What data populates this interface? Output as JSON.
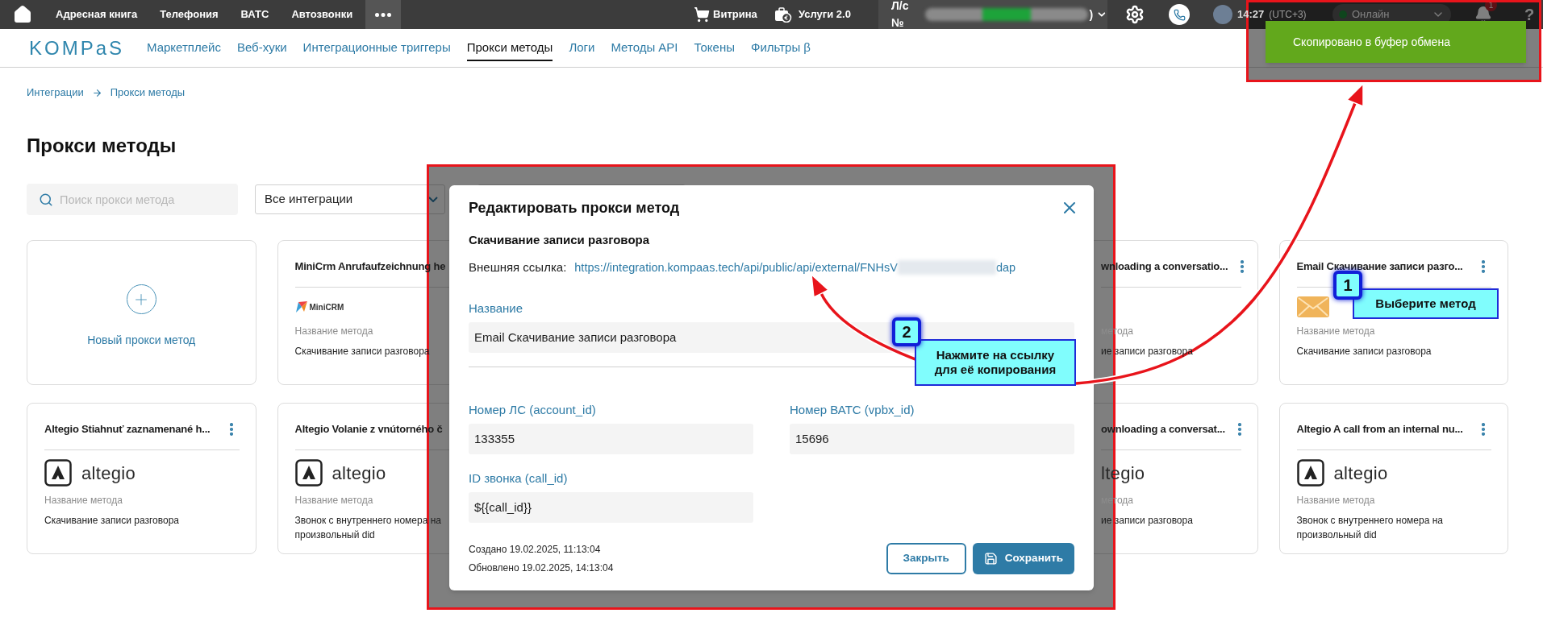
{
  "top_bar": {
    "nav_items": [
      {
        "label": "Адресная книга"
      },
      {
        "label": "Телефония"
      },
      {
        "label": "ВАТС"
      },
      {
        "label": "Автозвонки"
      }
    ],
    "shop": "Витрина",
    "services": "Услуги 2.0",
    "account_prefix": "Л/с №",
    "account_suffix": ")",
    "time": "14:27",
    "timezone": "(UTC+3)",
    "status": "Онлайн",
    "notifications": "1",
    "help": "?"
  },
  "nav": {
    "logo": "KOMPaS",
    "tabs": [
      {
        "label": "Маркетплейс",
        "selected": false
      },
      {
        "label": "Веб-хуки",
        "selected": false
      },
      {
        "label": "Интеграционные триггеры",
        "selected": false
      },
      {
        "label": "Прокси методы",
        "selected": true
      },
      {
        "label": "Логи",
        "selected": false
      },
      {
        "label": "Методы API",
        "selected": false
      },
      {
        "label": "Токены",
        "selected": false
      },
      {
        "label": "Фильтры β",
        "selected": false
      }
    ]
  },
  "breadcrumb": [
    "Интеграции",
    "Прокси методы"
  ],
  "title": "Прокси методы",
  "search": {
    "placeholder": "Поиск прокси метода"
  },
  "integration_filter": {
    "value": "Все интеграции"
  },
  "cards": [
    {
      "kind": "new",
      "label": "Новый прокси метод"
    },
    {
      "kind": "method",
      "title": "MiniCrm Anrufaufzeichnung he",
      "logo": {
        "kind": "minicrm",
        "text": "MiniCRM"
      },
      "field_label": "Название метода",
      "description": "Скачивание записи разговора"
    },
    {
      "kind": "covered"
    },
    {
      "kind": "covered"
    },
    {
      "kind": "partial",
      "title": "wnloading a conversatio...",
      "menu": true,
      "field_label": "метода",
      "description": "ие записи разговора"
    },
    {
      "kind": "method",
      "title": "Email Скачивание записи разго...",
      "menu": true,
      "logo": {
        "kind": "email"
      },
      "field_label": "Название метода",
      "description": "Скачивание записи разговора"
    },
    {
      "kind": "method",
      "title": "Altegio Stiahnuť zaznamenané h...",
      "menu": true,
      "logo": {
        "kind": "altegio",
        "text": "altegio"
      },
      "field_label": "Название метода",
      "description": "Скачивание записи разговора"
    },
    {
      "kind": "method",
      "title": "Altegio Volanie z vnútorného č",
      "logo": {
        "kind": "altegio",
        "text": "altegio"
      },
      "field_label": "Название метода",
      "description": "Звонок с внутреннего номера на произвольный did"
    },
    {
      "kind": "covered"
    },
    {
      "kind": "covered"
    },
    {
      "kind": "partial",
      "title": "ownloading a conversat...",
      "menu": true,
      "logo": {
        "kind": "text",
        "text": "ltegio"
      },
      "field_label": "метода",
      "description": "ие записи разговора"
    },
    {
      "kind": "method",
      "title": "Altegio A call from an internal nu...",
      "menu": true,
      "logo": {
        "kind": "altegio",
        "text": "altegio"
      },
      "field_label": "Название метода",
      "description": "Звонок с внутреннего номера на произвольный did"
    }
  ],
  "modal": {
    "title": "Редактировать прокси метод",
    "subtitle": "Скачивание записи разговора",
    "link_label": "Внешняя ссылка:",
    "link_start": "https://integration.kompaas.tech/api/public/api/external/FNHsV",
    "link_end": "dap",
    "fields": [
      {
        "kind": "wide",
        "label": "Название",
        "value": "Email Скачивание записи разговора"
      },
      {
        "kind": "half",
        "label": "Номер ЛС (account_id)",
        "value": "133355"
      },
      {
        "kind": "half",
        "label": "Номер ВАТС (vpbx_id)",
        "value": "15696"
      },
      {
        "kind": "half",
        "label": "ID звонка (call_id)",
        "value": "${{call_id}}"
      }
    ],
    "created": "Создано 19.02.2025, 11:13:04",
    "updated": "Обновлено 19.02.2025, 14:13:04",
    "buttons": [
      {
        "kind": "secondary",
        "label": "Закрыть"
      },
      {
        "kind": "primary",
        "label": "Сохранить"
      }
    ]
  },
  "toast": {
    "text": "Скопировано в буфер обмена"
  },
  "callouts": [
    {
      "number": "1",
      "lines": [
        "Выберите метод"
      ]
    },
    {
      "number": "2",
      "lines": [
        "Нажмите на ссылку",
        "для её копирования"
      ]
    }
  ]
}
